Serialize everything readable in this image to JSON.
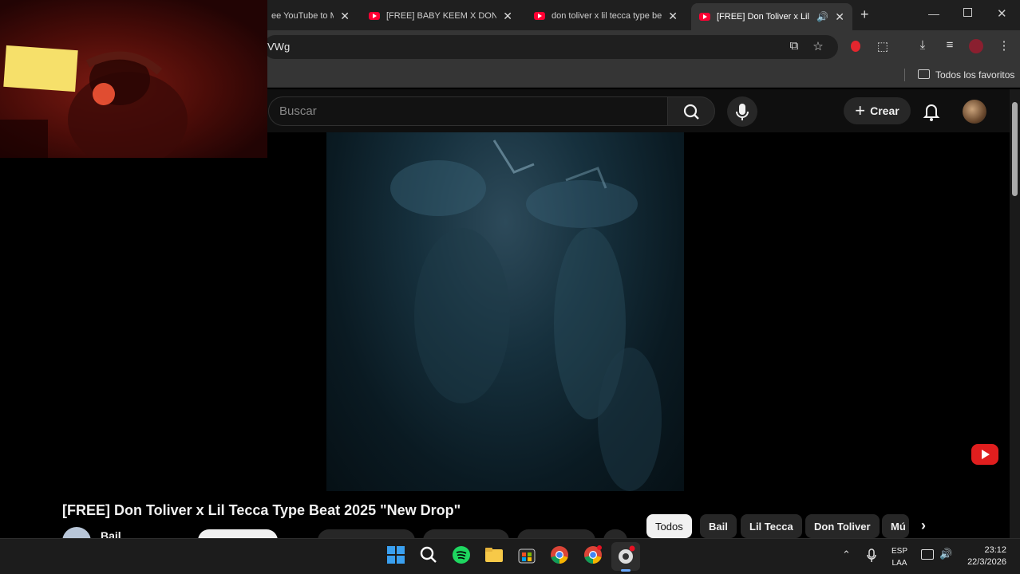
{
  "browser": {
    "tabs": [
      {
        "title": "ee YouTube to M"
      },
      {
        "title": "[FREE] BABY KEEM X DON TOLIVER"
      },
      {
        "title": "don toliver x lil tecca type beat"
      },
      {
        "title": "[FREE] Don Toliver x Lil Tecca"
      }
    ],
    "url": "VWg",
    "bookmarks_folder": "Todos los favoritos"
  },
  "youtube": {
    "search_placeholder": "Buscar",
    "create_label": "Crear",
    "video_title": "[FREE] Don Toliver x Lil Tecca Type Beat 2025 \"New Drop\"",
    "channel_name": "Bail",
    "chips": [
      "Todos",
      "Bail",
      "Lil Tecca",
      "Don Toliver",
      "Mú"
    ]
  },
  "taskbar": {
    "lang_top": "ESP",
    "lang_bottom": "LAA",
    "time": "23:12",
    "date": "22/3/2026"
  },
  "colors": {
    "youtube_red": "#ff0033",
    "chrome_dark": "#1f1f1f",
    "toolbar": "#353535",
    "yt_bg": "#0f0f0f"
  }
}
